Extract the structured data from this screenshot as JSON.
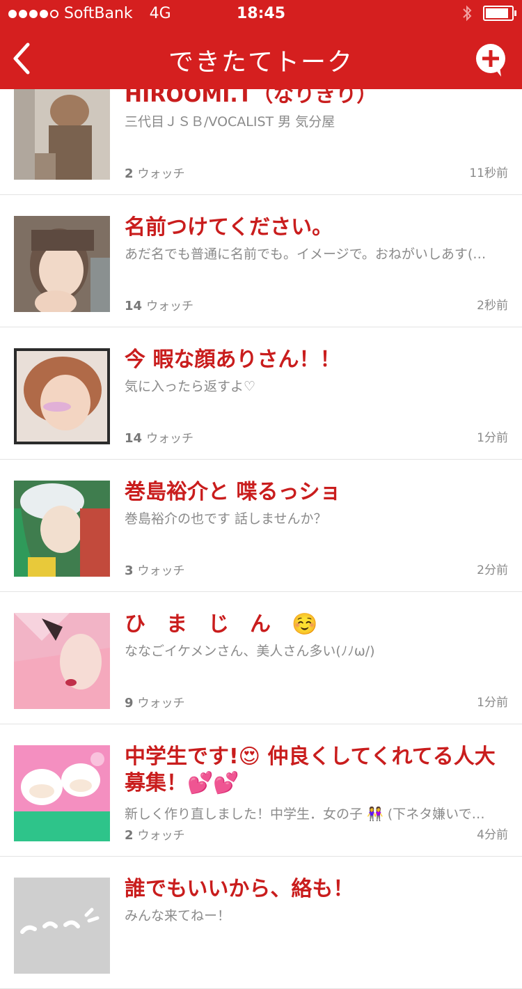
{
  "status_bar": {
    "carrier": "SoftBank",
    "network": "4G",
    "time": "18:45"
  },
  "navbar": {
    "title": "できたてトーク"
  },
  "colors": {
    "accent": "#d51f1f",
    "title_red": "#c91d1d",
    "meta_gray": "#8a8a8a"
  },
  "talks": [
    {
      "title": "HIROOMI.T（なりきり）",
      "subtitle": "三代目ＪＳＢ/VOCALIST 男 気分屋",
      "watch_count": "2",
      "watch_label": "ウォッチ",
      "time": "11秒前"
    },
    {
      "title": "名前つけてください。",
      "subtitle": "あだ名でも普通に名前でも。イメージで。おねがいしあす(…",
      "watch_count": "14",
      "watch_label": "ウォッチ",
      "time": "2秒前"
    },
    {
      "title": "今 暇な顔ありさん！！",
      "subtitle": "気に入ったら返すよ♡",
      "watch_count": "14",
      "watch_label": "ウォッチ",
      "time": "1分前"
    },
    {
      "title": "巻島裕介と 喋るっショ",
      "subtitle": "巻島裕介の也です 話しませんか？",
      "watch_count": "3",
      "watch_label": "ウォッチ",
      "time": "2分前"
    },
    {
      "title": "ひ　ま　じ　ん　☺️",
      "subtitle": "ななごイケメンさん、美人さん多い(ﾉﾉω/)",
      "watch_count": "9",
      "watch_label": "ウォッチ",
      "time": "1分前"
    },
    {
      "title": "中学生です!😍 仲良くしてくれてる人大募集！💕💕",
      "subtitle": "新しく作り直しました！中学生．女の子 👭 (下ネタ嫌いで…",
      "watch_count": "2",
      "watch_label": "ウォッチ",
      "time": "4分前"
    },
    {
      "title": "誰でもいいから、絡も！",
      "subtitle": "みんな来てねー！",
      "watch_count": "",
      "watch_label": "",
      "time": ""
    }
  ]
}
